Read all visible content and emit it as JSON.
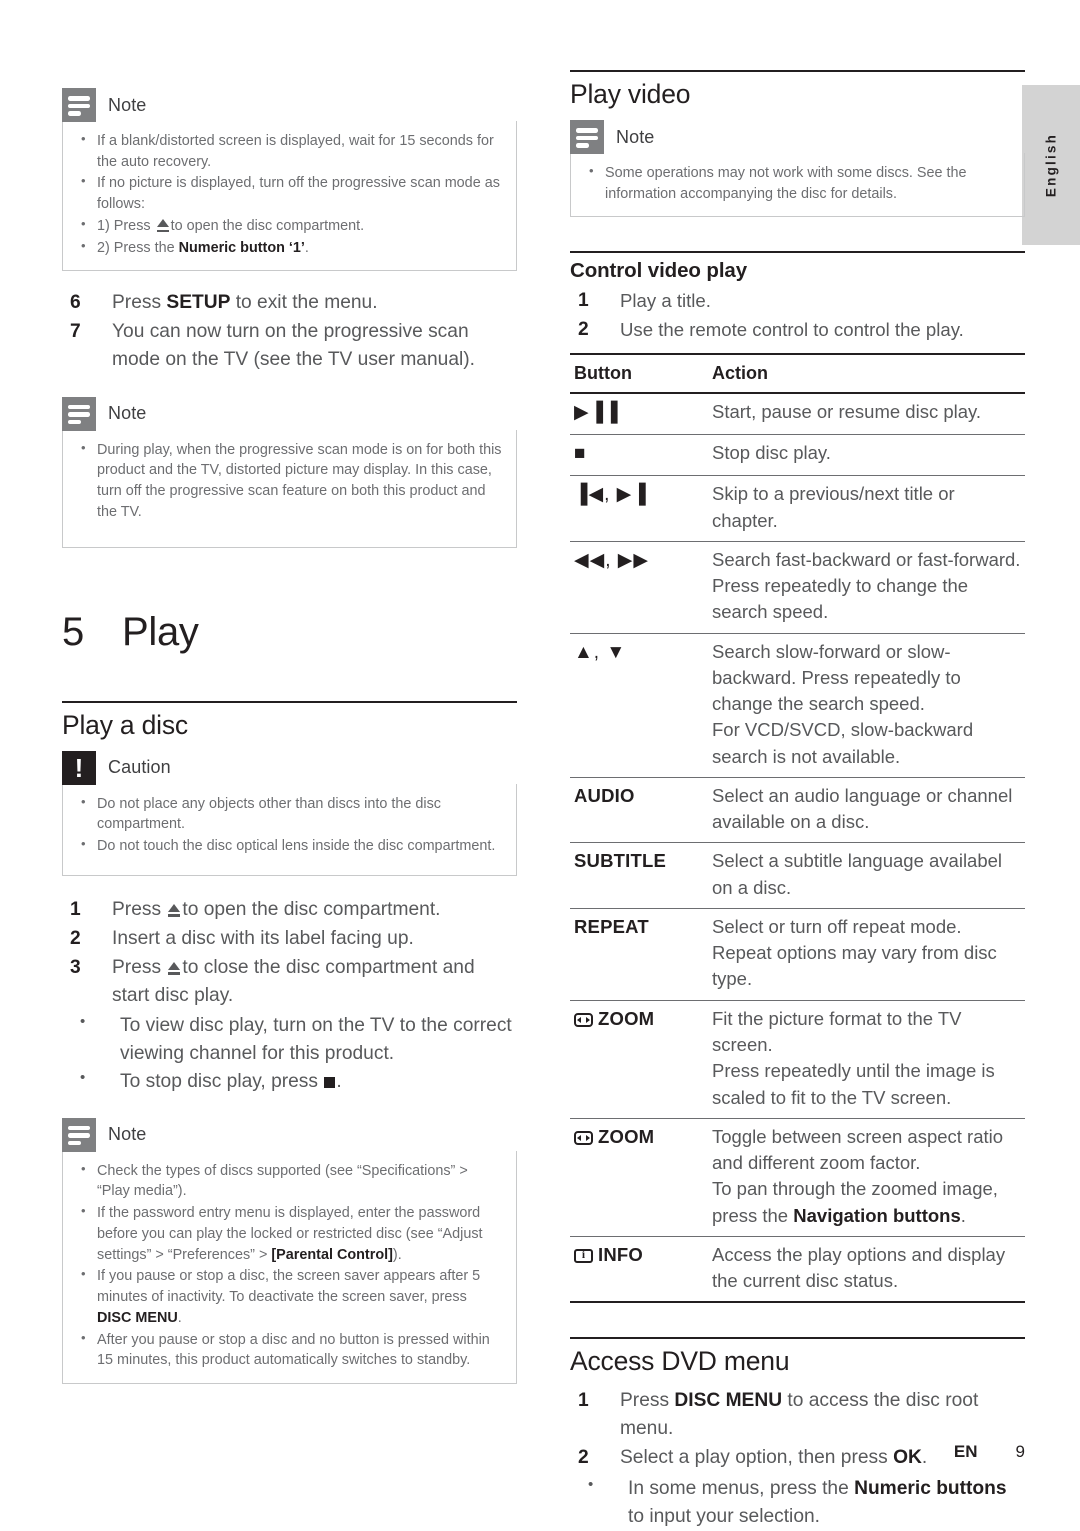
{
  "page": {
    "language_tab": "English",
    "footer_lang": "EN",
    "footer_page": "9"
  },
  "left_column": {
    "note_top": {
      "label": "Note",
      "items": [
        "If a blank/distorted screen is displayed, wait for 15 seconds for the auto recovery.",
        "If no picture is displayed, turn off the progressive scan mode as follows:",
        "1) Press ⏏ to open the disc compartment.",
        "2) Press the Numeric button ‘1’."
      ]
    },
    "steps_continued": [
      {
        "n": "6",
        "text": "Press SETUP to exit the menu."
      },
      {
        "n": "7",
        "text": "You can now turn on the progressive scan mode on the TV (see the TV user manual)."
      }
    ],
    "note_progressive": {
      "label": "Note",
      "items": [
        "During play, when the progressive scan mode is on for both this product and the TV, distorted picture may display. In this case, turn off the progressive scan feature on both this product and the TV."
      ]
    },
    "chapter": {
      "number": "5",
      "title": "Play"
    },
    "section_play_a_disc": {
      "heading": "Play a disc",
      "caution": {
        "label": "Caution",
        "items": [
          "Do not place any objects other than discs into the disc compartment.",
          "Do not touch the disc optical lens inside the disc compartment."
        ]
      },
      "steps": [
        {
          "n": "1",
          "text": "Press ⏏ to open the disc compartment."
        },
        {
          "n": "2",
          "text": "Insert a disc with its label facing up."
        },
        {
          "n": "3",
          "text": "Press ⏏ to close the disc compartment and start disc play."
        }
      ],
      "substeps": [
        "To view disc play, turn on the TV to the correct viewing channel for this product.",
        "To stop disc play, press ■."
      ],
      "note": {
        "label": "Note",
        "items": [
          "Check the types of discs supported (see “Specifications” > “Play media”).",
          "If the password entry menu is displayed, enter the password before you can play the locked or restricted disc (see “Adjust settings” > “Preferences” > [Parental Control]).",
          "If you pause or stop a disc, the screen saver appears after 5 minutes of inactivity. To deactivate the screen saver, press DISC MENU.",
          "After you pause or stop a disc and no button is pressed within 15 minutes, this product automatically switches to standby."
        ]
      }
    }
  },
  "right_column": {
    "section_play_video": {
      "heading": "Play video",
      "note": {
        "label": "Note",
        "items": [
          "Some operations may not work with some discs. See the information accompanying the disc for details."
        ]
      }
    },
    "section_control_video_play": {
      "heading": "Control video play",
      "steps": [
        {
          "n": "1",
          "text": "Play a title."
        },
        {
          "n": "2",
          "text": "Use the remote control to control the play."
        }
      ],
      "table": {
        "headers": [
          "Button",
          "Action"
        ],
        "rows": [
          {
            "button_icon": "play-pause-icon",
            "button_glyph": "▶▐▐",
            "button_label": "",
            "action": "Start, pause or resume disc play."
          },
          {
            "button_icon": "stop-icon",
            "button_glyph": "■",
            "button_label": "",
            "action": "Stop disc play."
          },
          {
            "button_icon": "skip-previous-next-icon",
            "button_glyph": "▐◀, ▶▐",
            "button_label": "",
            "action": "Skip to a previous/next title or chapter."
          },
          {
            "button_icon": "fast-backward-forward-icon",
            "button_glyph": "◀◀, ▶▶",
            "button_label": "",
            "action": "Search fast-backward or fast-forward. Press repeatedly to change the search speed."
          },
          {
            "button_icon": "up-down-arrow-icon",
            "button_glyph": "▲, ▼",
            "button_label": "",
            "action": "Search slow-forward or slow-backward. Press repeatedly to change the search speed.",
            "action_line2": "For VCD/SVCD, slow-backward search is not available."
          },
          {
            "button_icon": "",
            "button_glyph": "",
            "button_label": "AUDIO",
            "action": "Select an audio language or channel available on a disc."
          },
          {
            "button_icon": "",
            "button_glyph": "",
            "button_label": "SUBTITLE",
            "action": "Select a subtitle language availabel on a disc."
          },
          {
            "button_icon": "",
            "button_glyph": "",
            "button_label": "REPEAT",
            "action": "Select or turn off repeat mode. Repeat options may vary from disc type."
          },
          {
            "button_icon": "zoom-icon",
            "button_glyph": "",
            "button_label": "ZOOM",
            "action": "Fit the picture format to the TV screen.",
            "action_line2": "Press repeatedly until the image is scaled to fit to the TV screen."
          },
          {
            "button_icon": "zoom-icon",
            "button_glyph": "",
            "button_label": "ZOOM",
            "action": "Toggle between screen aspect ratio and different zoom factor.",
            "action_line2": "To pan through the zoomed image, press the Navigation buttons."
          },
          {
            "button_icon": "info-icon",
            "button_glyph": "",
            "button_label": "INFO",
            "action": "Access the play options and display the current disc status."
          }
        ]
      }
    },
    "section_access_dvd_menu": {
      "heading": "Access DVD menu",
      "steps": [
        {
          "n": "1",
          "text": "Press DISC MENU to access the disc root menu."
        },
        {
          "n": "2",
          "text": "Select a play option, then press OK."
        }
      ],
      "substeps": [
        "In some menus, press the Numeric buttons to input your selection."
      ]
    }
  }
}
